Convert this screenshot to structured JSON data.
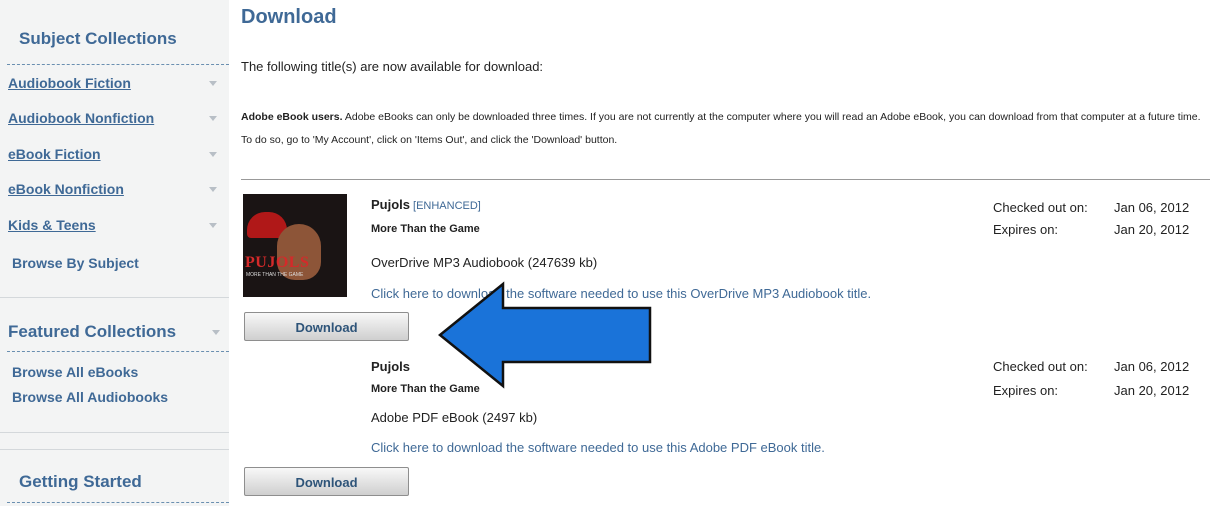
{
  "sidebar": {
    "subject_heading": "Subject Collections",
    "items": [
      {
        "label": "Audiobook Fiction"
      },
      {
        "label": "Audiobook Nonfiction"
      },
      {
        "label": "eBook Fiction"
      },
      {
        "label": "eBook Nonfiction"
      },
      {
        "label": "Kids & Teens"
      }
    ],
    "browse_by_subject": "Browse By Subject",
    "featured_heading": "Featured Collections",
    "featured_items": [
      {
        "label": "Browse All eBooks"
      },
      {
        "label": "Browse All Audiobooks"
      }
    ],
    "getting_started": "Getting Started"
  },
  "main": {
    "title": "Download",
    "intro": "The following title(s) are now available for download:",
    "note_bold": "Adobe eBook users.",
    "note_text": " Adobe eBooks can only be downloaded three times. If you are not currently at the computer where you will read an Adobe eBook, you can download from that computer at a future time. To do so, go to 'My Account', click on 'Items Out', and click the 'Download' button.",
    "checked_out_label": "Checked out on:",
    "expires_label": "Expires on:",
    "download_label": "Download",
    "titles": [
      {
        "title": "Pujols",
        "tag": "[ENHANCED]",
        "subtitle": "More Than the Game",
        "format": "OverDrive MP3 Audiobook (247639 kb)",
        "software_link": "Click here to download the software needed to use this OverDrive MP3 Audiobook title.",
        "checked_out": "Jan 06, 2012",
        "expires": "Jan 20, 2012",
        "cover_title": "PUJOLS",
        "cover_subtitle": "MORE THAN THE GAME"
      },
      {
        "title": "Pujols",
        "subtitle": "More Than the Game",
        "format": "Adobe PDF eBook (2497 kb)",
        "software_link": "Click here to download the software needed to use this Adobe PDF eBook title.",
        "checked_out": "Jan 06, 2012",
        "expires": "Jan 20, 2012"
      }
    ]
  },
  "colors": {
    "accent": "#3f6996",
    "sidebar_bg": "#f3f4f4",
    "arrow_fill": "#1a73d9"
  },
  "icons": {
    "sidebar_caret": "chevron-down-icon",
    "arrow": "arrow-left-icon"
  }
}
